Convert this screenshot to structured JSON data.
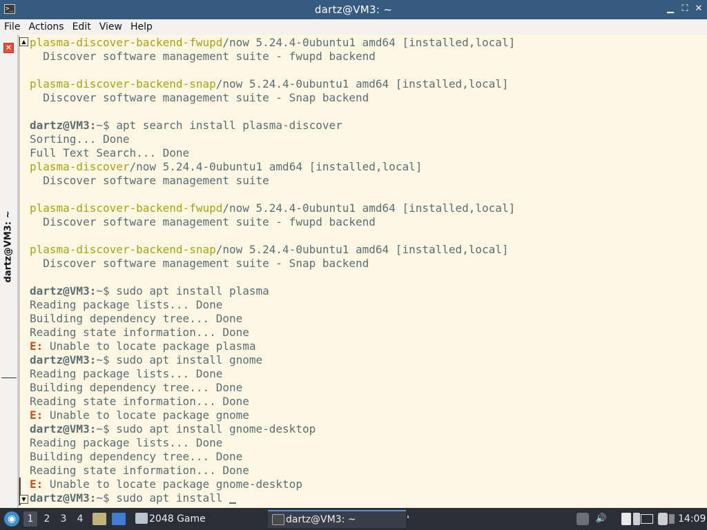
{
  "window": {
    "title": "dartz@VM3: ~",
    "minimize_glyph": "▁",
    "maximize_glyph": "⛶",
    "close_glyph": "✕",
    "app_icon_glyph": ">_"
  },
  "menu": [
    "File",
    "Actions",
    "Edit",
    "View",
    "Help"
  ],
  "side_tab": {
    "title": "dartz@VM3: ~",
    "close_glyph": "×"
  },
  "terminal": {
    "colors": {
      "package": "#a6a311",
      "error": "#cb4b16",
      "text": "#586e75",
      "background": "#fdf6e3"
    },
    "lines": [
      [
        {
          "t": "plasma-discover-backend-fwupd",
          "c": "pkg"
        },
        {
          "t": "/now 5.24.4-0ubuntu1 amd64 [installed,local]"
        }
      ],
      [
        {
          "t": "  Discover software management suite - fwupd backend"
        }
      ],
      [],
      [
        {
          "t": "plasma-discover-backend-snap",
          "c": "pkg"
        },
        {
          "t": "/now 5.24.4-0ubuntu1 amd64 [installed,local]"
        }
      ],
      [
        {
          "t": "  Discover software management suite - Snap backend"
        }
      ],
      [],
      [
        {
          "t": "dartz@VM3:",
          "c": "prompt"
        },
        {
          "t": "~$ apt search install plasma-discover"
        }
      ],
      [
        {
          "t": "Sorting... Done"
        }
      ],
      [
        {
          "t": "Full Text Search... Done"
        }
      ],
      [
        {
          "t": "plasma-discover",
          "c": "pkg"
        },
        {
          "t": "/now 5.24.4-0ubuntu1 amd64 [installed,local]"
        }
      ],
      [
        {
          "t": "  Discover software management suite"
        }
      ],
      [],
      [
        {
          "t": "plasma-discover-backend-fwupd",
          "c": "pkg"
        },
        {
          "t": "/now 5.24.4-0ubuntu1 amd64 [installed,local]"
        }
      ],
      [
        {
          "t": "  Discover software management suite - fwupd backend"
        }
      ],
      [],
      [
        {
          "t": "plasma-discover-backend-snap",
          "c": "pkg"
        },
        {
          "t": "/now 5.24.4-0ubuntu1 amd64 [installed,local]"
        }
      ],
      [
        {
          "t": "  Discover software management suite - Snap backend"
        }
      ],
      [],
      [
        {
          "t": "dartz@VM3:",
          "c": "prompt"
        },
        {
          "t": "~$ sudo apt install plasma"
        }
      ],
      [
        {
          "t": "Reading package lists... Done"
        }
      ],
      [
        {
          "t": "Building dependency tree... Done"
        }
      ],
      [
        {
          "t": "Reading state information... Done"
        }
      ],
      [
        {
          "t": "E:",
          "c": "err"
        },
        {
          "t": " Unable to locate package plasma"
        }
      ],
      [
        {
          "t": "dartz@VM3:",
          "c": "prompt"
        },
        {
          "t": "~$ sudo apt install gnome"
        }
      ],
      [
        {
          "t": "Reading package lists... Done"
        }
      ],
      [
        {
          "t": "Building dependency tree... Done"
        }
      ],
      [
        {
          "t": "Reading state information... Done"
        }
      ],
      [
        {
          "t": "E:",
          "c": "err"
        },
        {
          "t": " Unable to locate package gnome"
        }
      ],
      [
        {
          "t": "dartz@VM3:",
          "c": "prompt"
        },
        {
          "t": "~$ sudo apt install gnome-desktop"
        }
      ],
      [
        {
          "t": "Reading package lists... Done"
        }
      ],
      [
        {
          "t": "Building dependency tree... Done"
        }
      ],
      [
        {
          "t": "Reading state information... Done"
        }
      ],
      [
        {
          "t": "E:",
          "c": "err"
        },
        {
          "t": " Unable to locate package gnome-desktop"
        }
      ],
      [
        {
          "t": "dartz@VM3:",
          "c": "prompt"
        },
        {
          "t": "~$ sudo apt install "
        },
        {
          "t": "",
          "c": "cursor"
        }
      ]
    ]
  },
  "scrollbar": {
    "up_glyph": "▲",
    "down_glyph": "▼"
  },
  "taskbar": {
    "start_glyph": "◉",
    "workspaces": [
      "1",
      "2",
      "3",
      "4"
    ],
    "active_workspace": "1",
    "tasks": [
      {
        "label": "2048 Game",
        "active": false
      },
      {
        "label": "dartz@VM3: ~",
        "active": true
      }
    ],
    "volume_glyph": "🔊",
    "clock": "14:09"
  }
}
